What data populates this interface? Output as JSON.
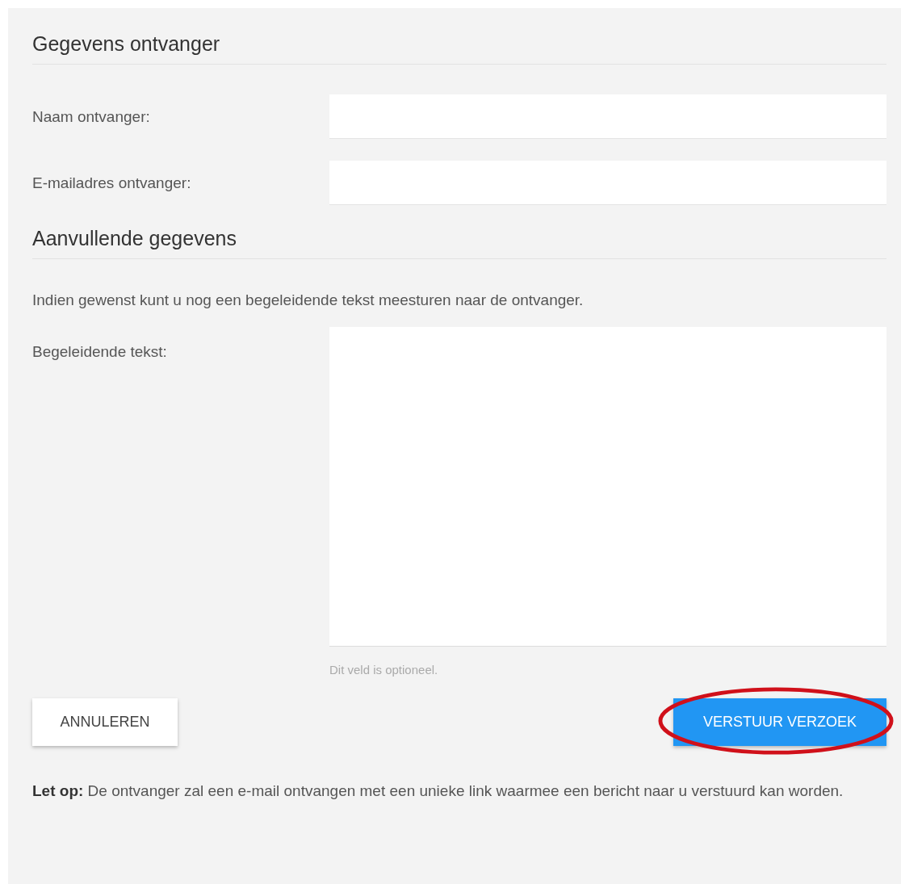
{
  "sections": [
    {
      "heading": "Gegevens ontvanger",
      "fields": [
        {
          "kind": "input",
          "label": "Naam ontvanger:"
        },
        {
          "kind": "input",
          "label": "E-mailadres ontvanger:"
        }
      ]
    },
    {
      "heading": "Aanvullende gegevens",
      "intro": "Indien gewenst kunt u nog een begeleidende tekst meesturen naar de ontvanger.",
      "fields": [
        {
          "kind": "textarea",
          "label": "Begeleidende tekst:",
          "hint": "Dit veld is optioneel."
        }
      ]
    }
  ],
  "buttons": [
    {
      "kind": "secondary",
      "label": "ANNULEREN",
      "highlighted": false
    },
    {
      "kind": "primary",
      "label": "VERSTUUR VERZOEK",
      "highlighted": true
    }
  ],
  "note": "**Let op:** De ontvanger zal een e-mail ontvangen met een unieke link waarmee een bericht naar u verstuurd kan worden."
}
